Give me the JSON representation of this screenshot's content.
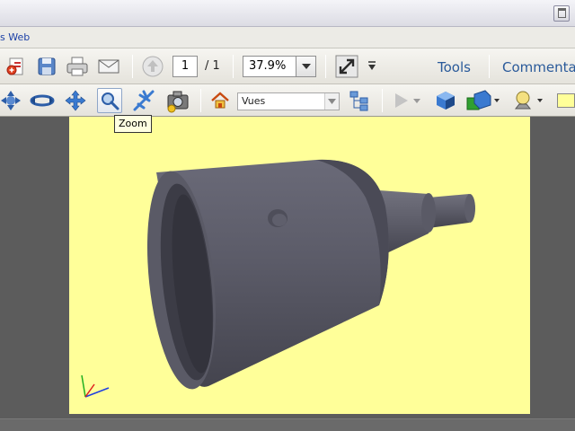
{
  "menubar": {
    "item": "s Web"
  },
  "toolbar": {
    "page_current": "1",
    "page_total": "/ 1",
    "zoom_value": "37.9%",
    "tools_label": "Tools",
    "comment_label": "Commenta"
  },
  "toolbar3d": {
    "views_value": "Vues",
    "tooltip": "Zoom"
  },
  "colors": {
    "viewport_bg": "#ffff99",
    "model_body": "#5a5a66",
    "link_blue": "#2a5a9a"
  },
  "icons": [
    "create-pdf-icon",
    "save-icon",
    "print-icon",
    "email-icon",
    "page-up-icon",
    "expand-icon",
    "rotate-icon",
    "spin-icon",
    "pan-icon",
    "zoom-icon",
    "fly-icon",
    "camera-icon",
    "home-icon",
    "model-tree-icon",
    "play-icon",
    "cube-icon",
    "render-mode-icon",
    "lighting-icon"
  ]
}
